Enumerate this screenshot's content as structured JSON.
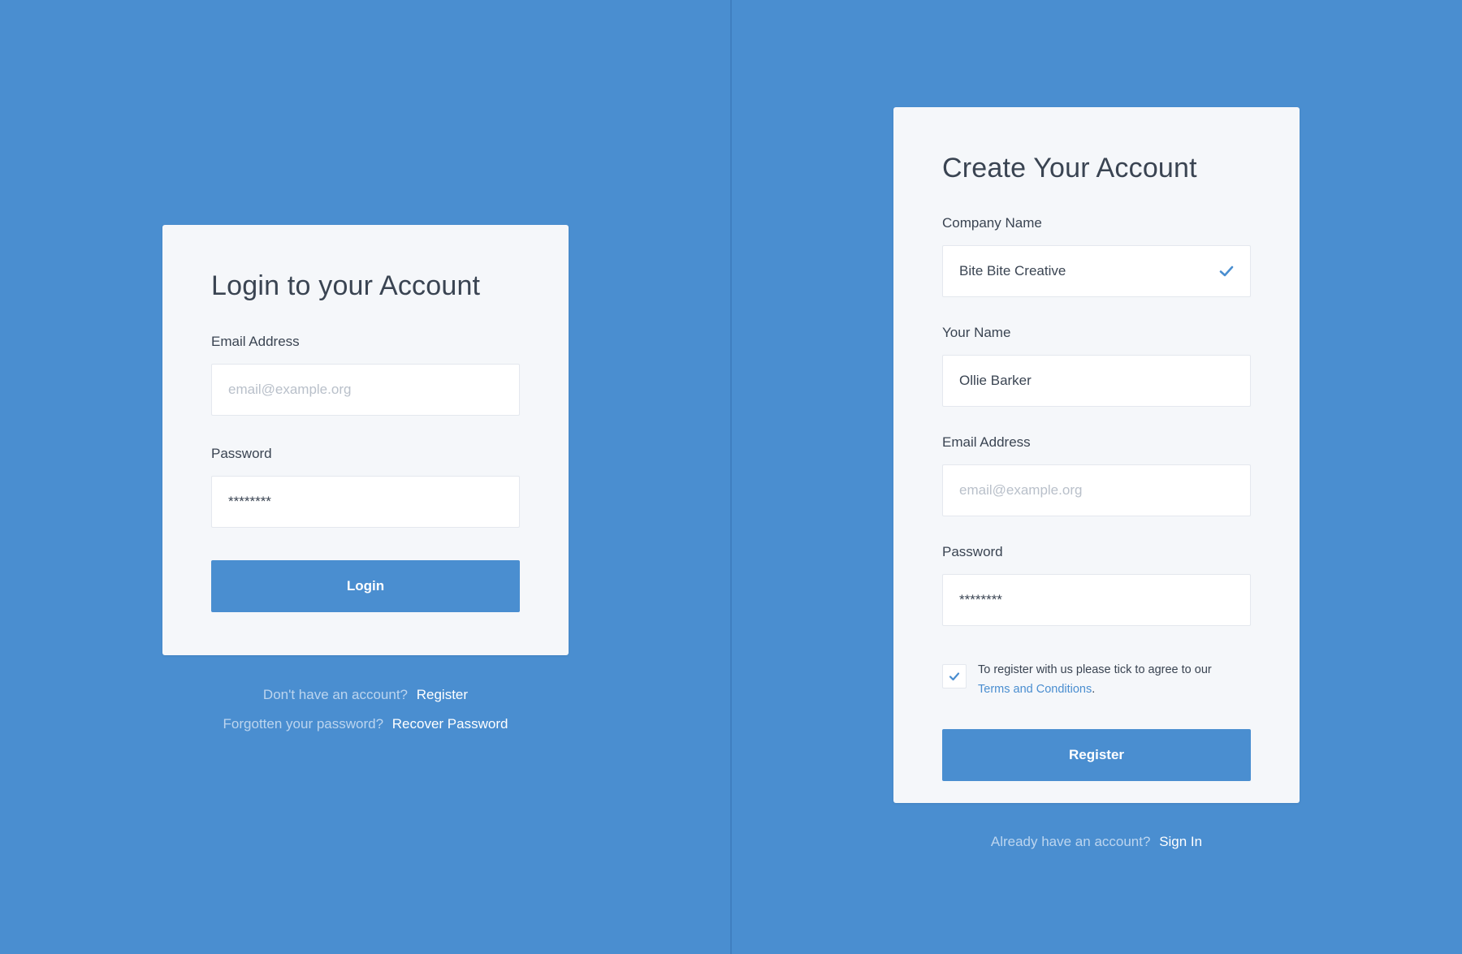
{
  "login": {
    "title": "Login to your Account",
    "email_label": "Email Address",
    "email_placeholder": "email@example.org",
    "email_value": "",
    "password_label": "Password",
    "password_value": "********",
    "submit_label": "Login",
    "footer": {
      "no_account_text": "Don't have an account?",
      "register_link": "Register",
      "forgot_text": "Forgotten your password?",
      "recover_link": "Recover Password"
    }
  },
  "register": {
    "title": "Create Your Account",
    "company_label": "Company Name",
    "company_value": "Bite Bite Creative",
    "name_label": "Your Name",
    "name_value": "Ollie Barker",
    "email_label": "Email Address",
    "email_placeholder": "email@example.org",
    "email_value": "",
    "password_label": "Password",
    "password_value": "********",
    "terms_text": "To register with us please tick to agree to our",
    "terms_link": "Terms and Conditions",
    "terms_period": ".",
    "submit_label": "Register",
    "footer": {
      "have_account_text": "Already have an account?",
      "signin_link": "Sign In"
    }
  },
  "icons": {
    "company_valid": "check-icon",
    "terms_checkbox": "check-icon"
  },
  "colors": {
    "background": "#4a8ed0",
    "card": "#f5f7fa",
    "accent": "#4a8ed0",
    "text": "#3a4452",
    "placeholder": "#b9c0ca"
  }
}
